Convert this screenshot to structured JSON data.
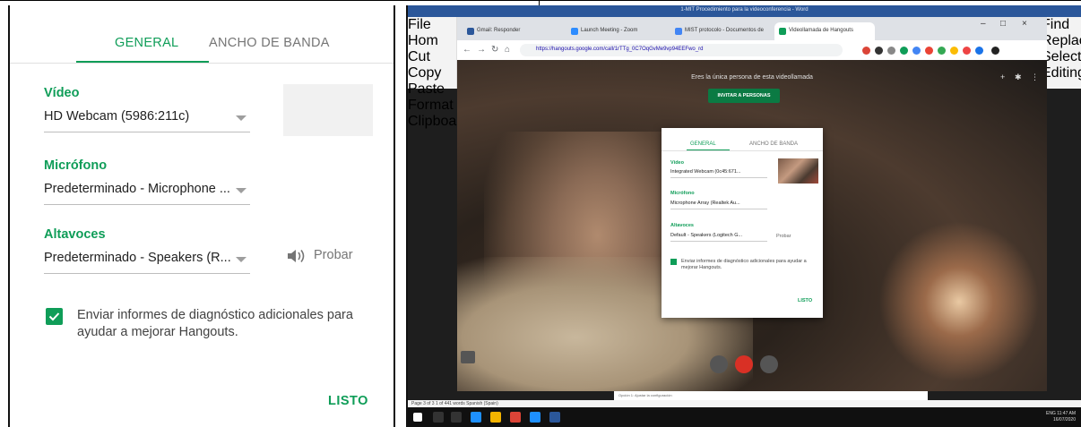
{
  "settings_panel": {
    "tabs": [
      {
        "label": "GENERAL",
        "active": true
      },
      {
        "label": "ANCHO DE BANDA",
        "active": false
      }
    ],
    "video": {
      "label": "Vídeo",
      "value": "HD Webcam (5986:211c)"
    },
    "microphone": {
      "label": "Micrófono",
      "value": "Predeterminado - Microphone ..."
    },
    "speakers": {
      "label": "Altavoces",
      "value": "Predeterminado - Speakers (R...",
      "test_label": "Probar"
    },
    "diagnostics": {
      "checked": true,
      "label": "Enviar informes de diagnóstico adicionales para ayudar a mejorar Hangouts."
    },
    "done_label": "LISTO"
  },
  "screenshot": {
    "word_title": "1-MIT Procedimiento para la videoconferencia - Word",
    "ribbon_left": [
      "File",
      "Hom",
      "Cut",
      "Copy",
      "Paste",
      "Format",
      "Clipboard"
    ],
    "ribbon_right": [
      "Find",
      "Replace",
      "Select",
      "Editing"
    ],
    "browser_tabs": [
      {
        "label": "Gmail: Responder",
        "color": "#2b579a"
      },
      {
        "label": "Launch Meeting - Zoom",
        "color": "#2d8cff"
      },
      {
        "label": "MIST protocolo - Documentos de",
        "color": "#4285f4"
      },
      {
        "label": "Videollamada de Hangouts",
        "color": "#0f9d58",
        "active": true
      }
    ],
    "url": "https://hangouts.google.com/call/1rTTg_0C7OqGvMe9vp94EEFwo_rd",
    "video_banner": "Eres la única persona de esta videollamada",
    "invite_button": "INVITAR A PERSONAS",
    "dialog": {
      "tabs": [
        "GENERAL",
        "ANCHO DE BANDA"
      ],
      "video_label": "Vídeo",
      "video_value": "Integrated Webcam (0c45:671...",
      "mic_label": "Micrófono",
      "mic_value": "Microphone Array (Realtek Au...",
      "speakers_label": "Altavoces",
      "speakers_value": "Default - Speakers (Logitech G...",
      "test_label": "Probar",
      "diagnostics": "Enviar informes de diagnóstico adicionales para ayudar a mejorar Hangouts.",
      "done": "LISTO"
    },
    "doc_snippet": "Opción 1: Ajustar la configuración",
    "status_bar": "Page 3 of 3    1 of 441 words    Spanish (Spain)",
    "tray_time": "11:47 AM",
    "tray_date": "16/07/2020",
    "tray_lang": "ENG"
  }
}
